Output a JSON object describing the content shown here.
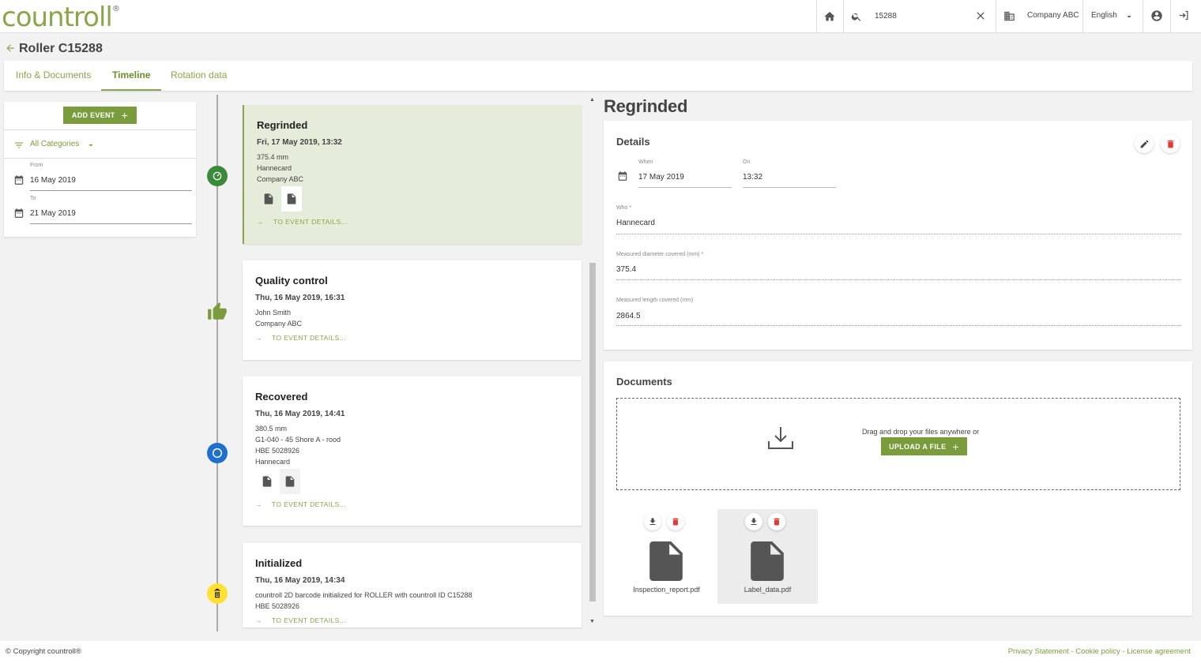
{
  "brand": {
    "name": "countroll",
    "registered": "®"
  },
  "topbar": {
    "search_value": "15288",
    "company": "Company ABC",
    "language": "English"
  },
  "page": {
    "title": "Roller C15288"
  },
  "tabs": [
    {
      "label": "Info & Documents"
    },
    {
      "label": "Timeline"
    },
    {
      "label": "Rotation data"
    }
  ],
  "filters": {
    "add_event_label": "ADD EVENT",
    "category": "All Categories",
    "from_label": "From",
    "from_value": "16 May 2019",
    "to_label": "To",
    "to_value": "21 May 2019"
  },
  "timeline": {
    "link_label": "TO EVENT DETAILS...",
    "events": [
      {
        "title": "Regrinded",
        "date": "Fri, 17 May 2019, 13:32",
        "lines": [
          "375.4 mm",
          "Hannecard",
          "Company ABC"
        ]
      },
      {
        "title": "Quality control",
        "date": "Thu, 16 May 2019, 16:31",
        "lines": [
          "John Smith",
          "Company ABC"
        ]
      },
      {
        "title": "Recovered",
        "date": "Thu, 16 May 2019, 14:41",
        "lines": [
          "380.5 mm",
          "G1-040 - 45 Shore A - rood",
          "HBE 5028926",
          "Hannecard"
        ]
      },
      {
        "title": "Initialized",
        "date": "Thu, 16 May 2019, 14:34",
        "lines": [
          "countroll 2D barcode initialized for ROLLER with countroll ID C15288",
          "HBE 5028926"
        ]
      }
    ]
  },
  "detail": {
    "title": "Regrinded",
    "details_heading": "Details",
    "when_label": "When",
    "when_value": "17 May 2019",
    "on_label": "On",
    "on_value": "13:32",
    "who_label": "Who *",
    "who_value": "Hannecard",
    "diameter_label": "Measured diameter covered (mm) *",
    "diameter_value": "375.4",
    "length_label": "Measured length covered (mm)",
    "length_value": "2864.5"
  },
  "documents": {
    "heading": "Documents",
    "drop_text": "Drag and drop your files anywhere or",
    "upload_label": "UPLOAD A FILE",
    "files": [
      {
        "name": "Inspection_report.pdf"
      },
      {
        "name": "Label_data.pdf"
      }
    ]
  },
  "footer": {
    "copyright": "© Copyright countroll®",
    "links": "Privacy Statement - Cookie policy - License agreement"
  },
  "colors": {
    "brand_green": "#7b9c3c",
    "delete_red": "#e53935",
    "node_blue": "#1e6fd0",
    "node_yellow": "#ffe033",
    "node_green": "#3a8a3a"
  }
}
